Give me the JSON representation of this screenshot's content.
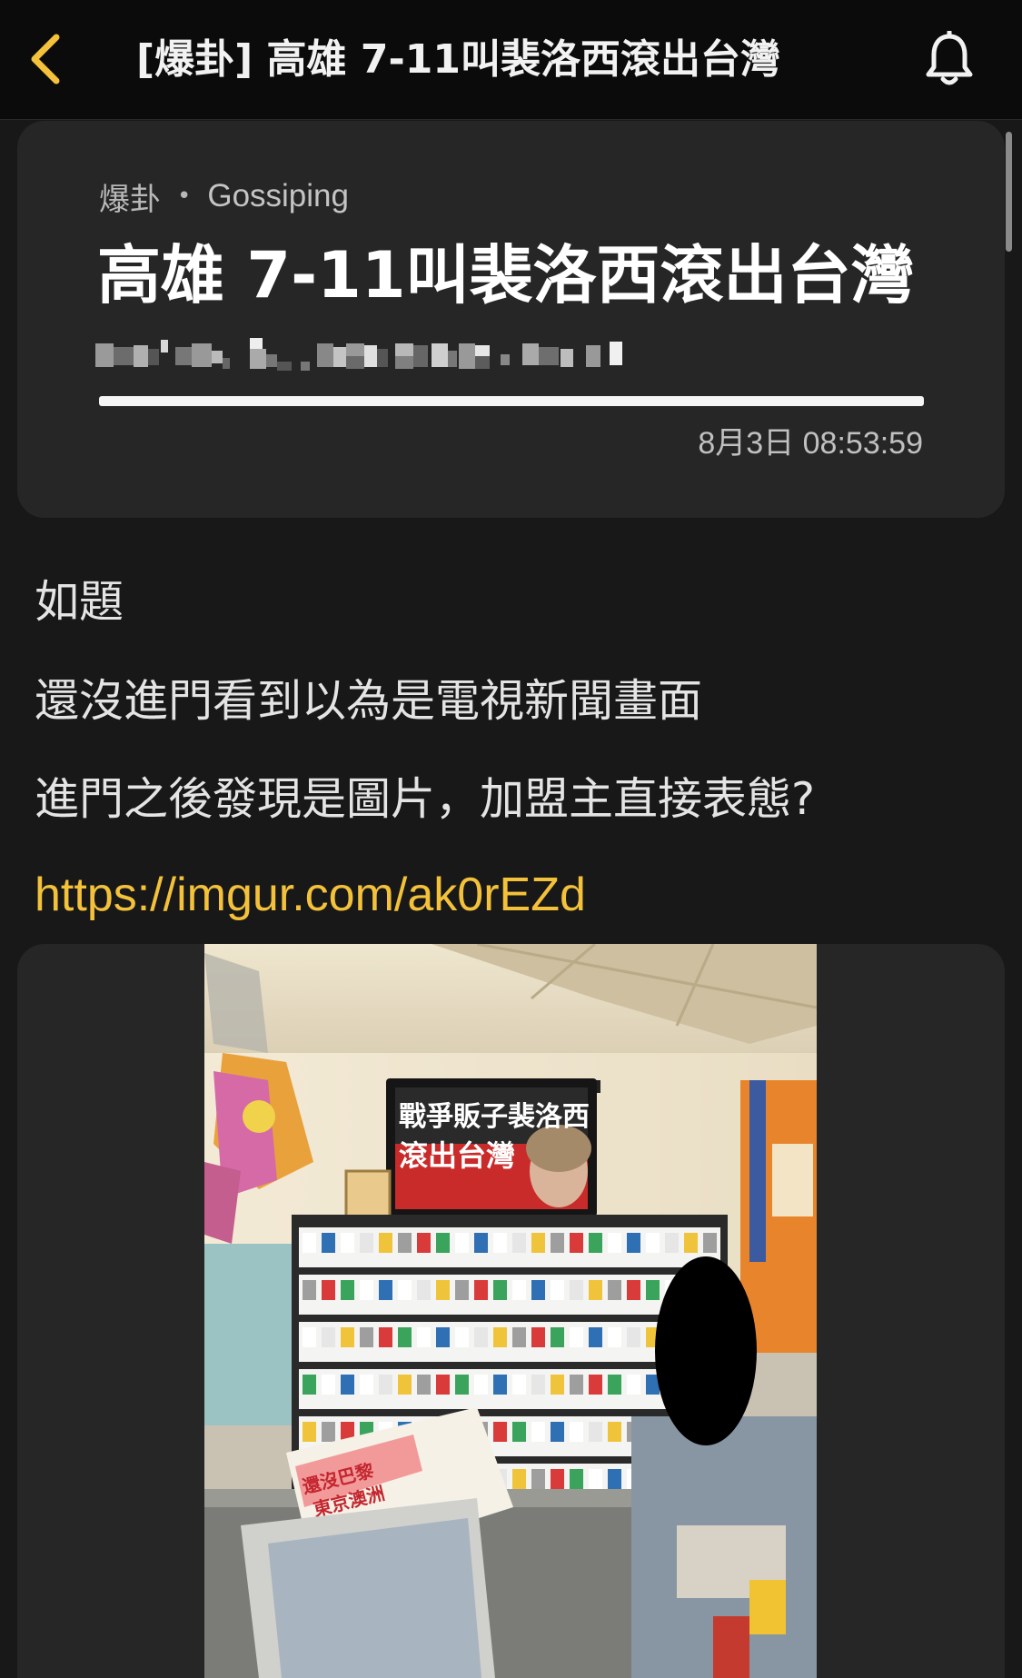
{
  "navbar": {
    "title": "[爆卦] 高雄 7-11叫裴洛西滾出台灣",
    "back_icon": "chevron-left-icon",
    "bell_icon": "bell-icon",
    "accent_color": "#f3c13a"
  },
  "post": {
    "board_label": "爆卦",
    "board_name": "Gossiping",
    "title": "高雄 7-11叫裴洛西滾出台灣",
    "timestamp": "8月3日 08:53:59",
    "read_progress": 1.0,
    "body_lines": [
      "如題",
      "還沒進門看到以為是電視新聞畫面",
      "進門之後發現是圖片，加盟主直接表態?"
    ],
    "link": "https://imgur.com/ak0rEZd"
  },
  "photo": {
    "tv_text_line1": "戰爭販子裴洛西",
    "tv_text_line2": "滾出台灣",
    "sign_text_line1": "還沒巴黎",
    "sign_text_line2": "東京澳洲"
  }
}
